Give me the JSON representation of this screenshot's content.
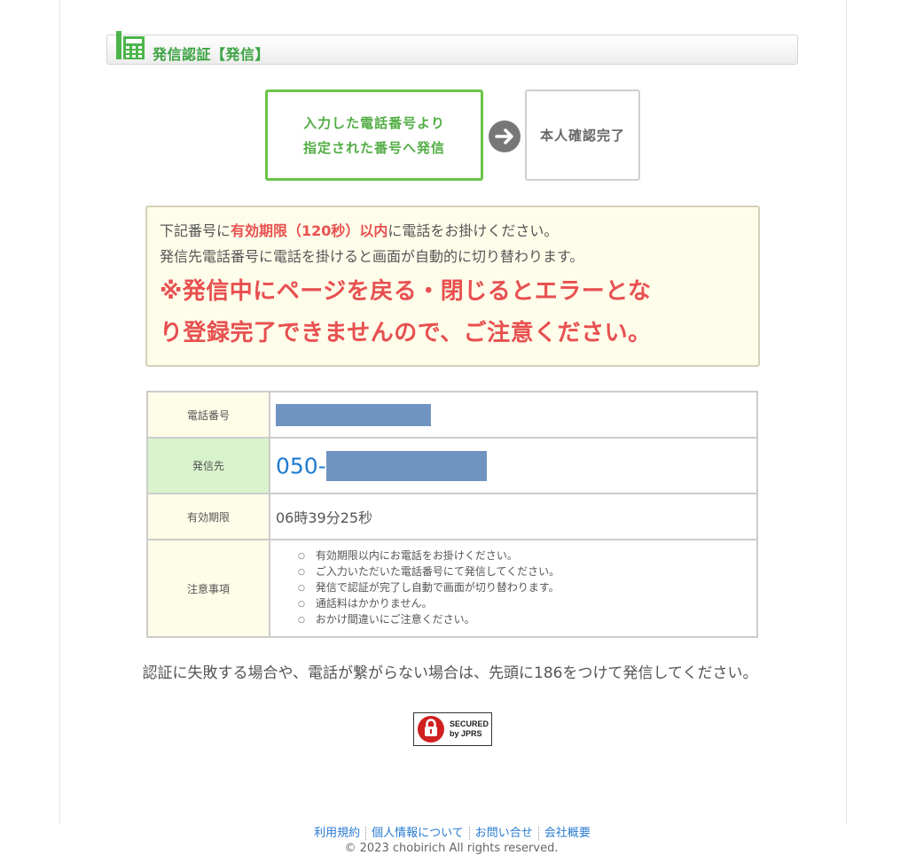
{
  "header": {
    "title": "発信認証【発信】",
    "icon": "phone-keypad-icon"
  },
  "steps": {
    "step1_line1": "入力した電話番号より",
    "step1_line2": "指定された番号へ発信",
    "step2": "本人確認完了"
  },
  "notice": {
    "line1_pre": "下記番号に",
    "line1_highlight": "有効期限（120秒）以内",
    "line1_post": "に電話をお掛けください。",
    "line2": "発信先電話番号に電話を掛けると画面が自動的に切り替わります。",
    "warning_line1": "※発信中にページを戻る・閉じるとエラーとな",
    "warning_line2": "り登録完了できませんので、ご注意ください。"
  },
  "table": {
    "tel_label": "電話番号",
    "dst_label": "発信先",
    "dst_prefix": "050-",
    "exp_label": "有効期限",
    "exp_value": "06時39分25秒",
    "notes_label": "注意事項",
    "notes": [
      "有効期限以内にお電話をお掛けください。",
      "ご入力いただいた電話番号にて発信してください。",
      "発信で認証が完了し自動で画面が切り替わります。",
      "通話料はかかりません。",
      "おかけ間違いにご注意ください。"
    ]
  },
  "fallback_text": "認証に失敗する場合や、電話が繋がらない場合は、先頭に186をつけて発信してください。",
  "seal": {
    "line1": "SECURED",
    "line2": "by JPRS"
  },
  "footer": {
    "links": [
      "利用規約",
      "個人情報について",
      "お問い合せ",
      "会社概要"
    ],
    "copyright": "© 2023 chobirich All rights reserved."
  },
  "colors": {
    "accent_green": "#52ad45",
    "warning_red": "#e85050",
    "link_blue": "#2a7bd0",
    "mask_blue": "#7094c2"
  }
}
